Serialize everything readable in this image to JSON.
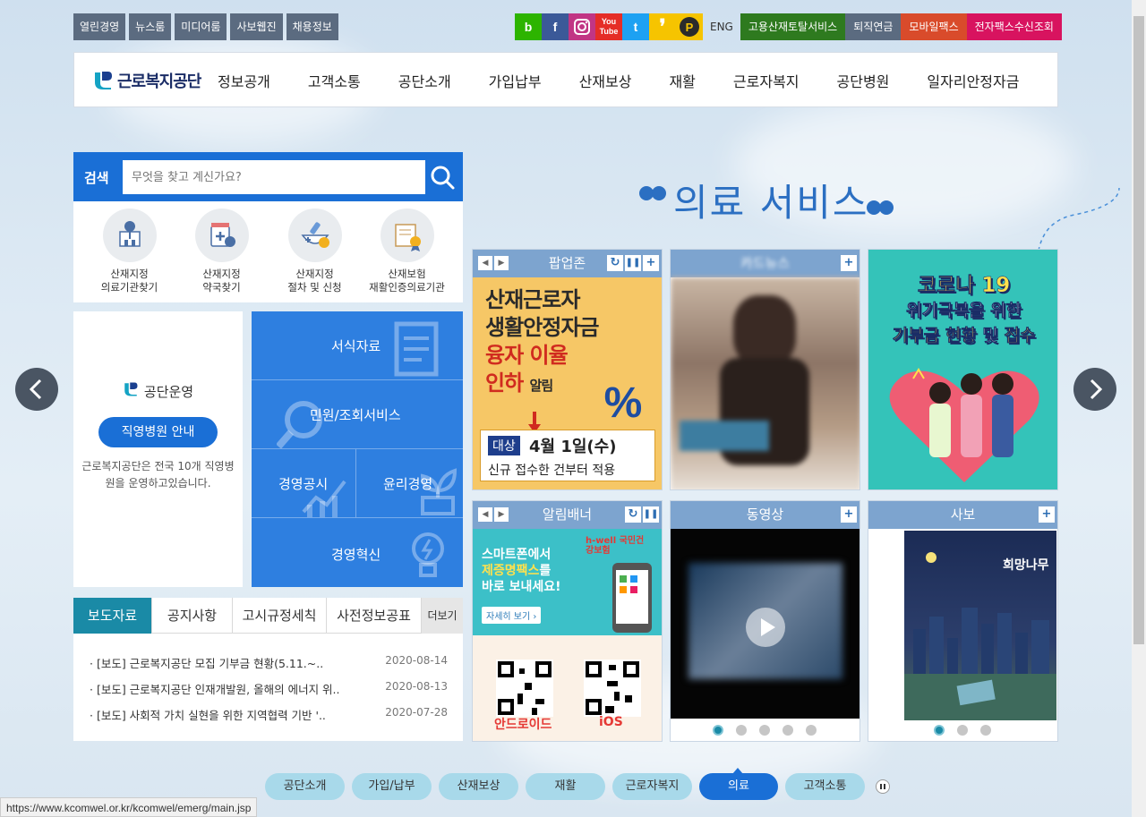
{
  "util_links": [
    "열린경영",
    "뉴스룸",
    "미디어룸",
    "사보웹진",
    "채용정보"
  ],
  "sns": [
    {
      "name": "blog",
      "glyph": "b",
      "color": "#2db400"
    },
    {
      "name": "facebook",
      "glyph": "f",
      "color": "#3b5998"
    },
    {
      "name": "instagram",
      "glyph": "◎",
      "color": "#c13584"
    },
    {
      "name": "youtube",
      "glyph": "You Tube",
      "color": "#e52d27"
    },
    {
      "name": "twitter",
      "glyph": "t",
      "color": "#1da1f2"
    },
    {
      "name": "kakaostory",
      "glyph": "❜",
      "color": "#f6c400"
    },
    {
      "name": "kakao-plus",
      "glyph": "P",
      "color": "#f6c400"
    }
  ],
  "eng_label": "ENG",
  "service_links": [
    {
      "label": "고용산재토탈서비스",
      "color": "#2e7a1f"
    },
    {
      "label": "퇴직연금",
      "color": "#5b6b80"
    },
    {
      "label": "모바일팩스",
      "color": "#d94b2b"
    },
    {
      "label": "전자팩스수신조회",
      "color": "#d8135f"
    }
  ],
  "logo_text": "근로복지공단",
  "gnb": [
    "정보공개",
    "고객소통",
    "공단소개",
    "가입납부",
    "산재보상",
    "재활",
    "근로자복지",
    "공단병원",
    "일자리안정자금"
  ],
  "search": {
    "label": "검색",
    "placeholder": "무엇을 찾고 계신가요?"
  },
  "quick_links": [
    {
      "line1": "산재지정",
      "line2": "의료기관찾기"
    },
    {
      "line1": "산재지정",
      "line2": "약국찾기"
    },
    {
      "line1": "산재지정",
      "line2": "절차 및 신청"
    },
    {
      "line1": "산재보험",
      "line2": "재활인증의료기관"
    }
  ],
  "operation": {
    "title": "공단운영",
    "button": "직영병원 안내",
    "desc": "근로복지공단은 전국 10개 직영병원을 운영하고있습니다."
  },
  "tiles": {
    "forms": "서식자료",
    "civil": "민원/조회서비스",
    "disclosure": "경영공시",
    "ethics": "윤리경영",
    "innovation": "경영혁신"
  },
  "board": {
    "tabs": [
      "보도자료",
      "공지사항",
      "고시규정세칙",
      "사전정보공표"
    ],
    "more": "더보기",
    "items": [
      {
        "title": "[보도] 근로복지공단 모집 기부금 현황(5.11.~..",
        "date": "2020-08-14"
      },
      {
        "title": "[보도] 근로복지공단 인재개발원, 올해의 에너지 위..",
        "date": "2020-08-13"
      },
      {
        "title": "[보도] 사회적 가치 실현을 위한 지역협력 기반 '..",
        "date": "2020-07-28"
      }
    ]
  },
  "section_title": "의료 서비스",
  "cards": {
    "popup": {
      "title": "팝업존",
      "line1": "산재근로자",
      "line2": "생활안정자금",
      "line3": "융자 이율",
      "line4a": "인하",
      "line4b": "알림",
      "badge": "대상",
      "date_text": "4월 1일(수)",
      "sub": "신규 접수한 건부터 적용"
    },
    "cardnews": {
      "title": "카드뉴스"
    },
    "corona": {
      "line1": "코로나 19",
      "line2": "위기극복을 위한",
      "line3a": "기부금 현황",
      "line3b": "및",
      "line3c": "접수"
    },
    "alarm": {
      "title": "알림배너",
      "brand": "h-well 국민건강보험",
      "line1": "스마트폰에서",
      "line2a": "제증명팩스",
      "line2b": "를",
      "line3": "바로 보내세요!",
      "more": "자세히 보기 ›",
      "android": "안드로이드",
      "ios": "iOS"
    },
    "video": {
      "title": "동영상"
    },
    "magazine": {
      "title": "사보",
      "mag_name": "희망나무"
    }
  },
  "bottom_nav": [
    "공단소개",
    "가입/납부",
    "산재보상",
    "재활",
    "근로자복지",
    "의료",
    "고객소통"
  ],
  "bottom_nav_active": "의료",
  "status_url": "https://www.kcomwel.or.kr/kcomwel/emerg/main.jsp",
  "colors": {
    "primary": "#1a6fd6",
    "teal": "#1a8aa6",
    "card_head": "#7da4cf"
  }
}
